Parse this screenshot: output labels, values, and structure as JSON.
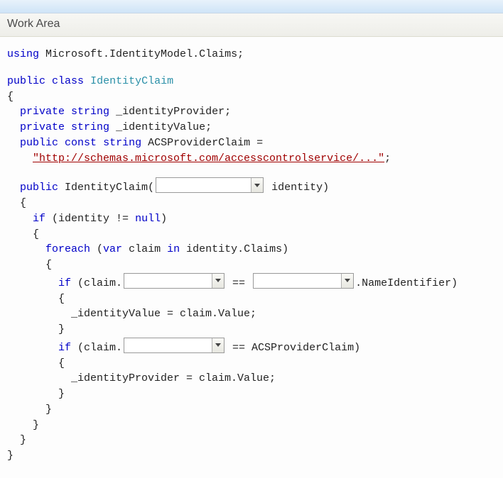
{
  "header": {
    "title": "Work Area"
  },
  "code": {
    "using_kw": "using",
    "using_ns": "Microsoft.IdentityModel.Claims;",
    "public_kw": "public",
    "private_kw": "private",
    "class_kw": "class",
    "const_kw": "const",
    "string_kw": "string",
    "var_kw": "var",
    "if_kw": "if",
    "foreach_kw": "foreach",
    "in_kw": "in",
    "null_kw": "null",
    "class_name": "IdentityClaim",
    "field1": "_identityProvider;",
    "field2": "_identityValue;",
    "const_name": "ACSProviderClaim =",
    "const_value": "\"http://schemas.microsoft.com/accesscontrolservice/...\"",
    "ctor_open": "IdentityClaim(",
    "ctor_close_param": " identity)",
    "cond_open": "(identity != ",
    "cond_close": ")",
    "foreach_open_a": "(",
    "foreach_mid1": " claim ",
    "foreach_mid2": " identity.Claims)",
    "if_claim_open": "(claim.",
    "eq_mid": " == ",
    "name_identifier_close": ".NameIdentifier)",
    "assign_value": "_identityValue = claim.Value;",
    "acs_close": " == ACSProviderClaim)",
    "assign_provider": "_identityProvider = claim.Value;",
    "obrace": "{",
    "cbrace": "}",
    "semicolon": ";"
  }
}
